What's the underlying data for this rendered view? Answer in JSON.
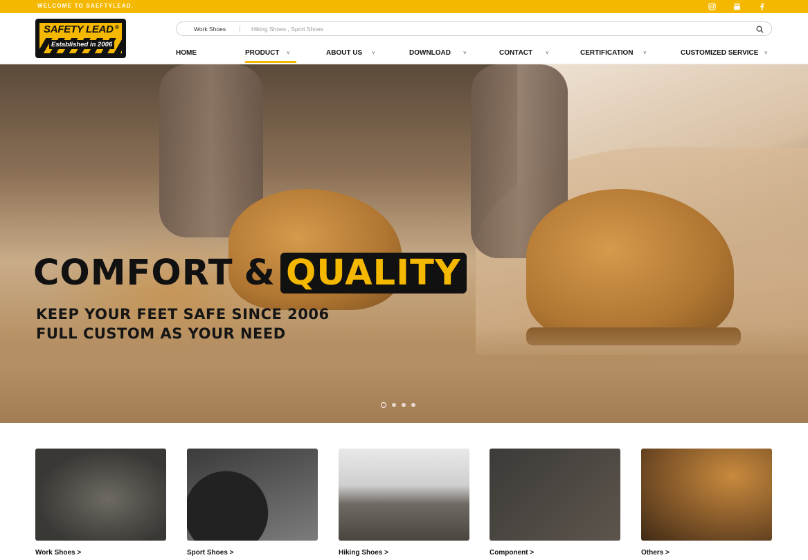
{
  "topbar": {
    "welcome_text": "WELCOME TO SAEFTYLEAD.",
    "social_icons": [
      "instagram-icon",
      "youtube-icon",
      "facebook-icon"
    ]
  },
  "logo": {
    "name": "SAFETY LEAD",
    "registered": "®",
    "tagline": "Established in 2006"
  },
  "search": {
    "category": "Work Shoes",
    "placeholder": "Hiking Shoes , Sport Shoes"
  },
  "nav": {
    "items": [
      {
        "label": "HOME",
        "has_dropdown": false
      },
      {
        "label": "PRODUCT",
        "has_dropdown": true,
        "active": true
      },
      {
        "label": "ABOUT US",
        "has_dropdown": true
      },
      {
        "label": "DOWNLOAD",
        "has_dropdown": true
      },
      {
        "label": "CONTACT",
        "has_dropdown": true
      },
      {
        "label": "CERTIFICATION",
        "has_dropdown": true
      },
      {
        "label": "CUSTOMIZED SERVICE",
        "has_dropdown": true
      }
    ],
    "caret": "˅"
  },
  "hero": {
    "title_part1": "COMFORT",
    "title_amp": "&",
    "title_part2": "QUALITY",
    "subtitle_line1": "KEEP YOUR FEET SAFE SINCE 2006",
    "subtitle_line2": "FULL CUSTOM AS YOUR NEED",
    "slide_count": 4,
    "active_slide": 1
  },
  "categories": [
    {
      "label": "Work Shoes >"
    },
    {
      "label": "Sport Shoes >"
    },
    {
      "label": "Hiking Shoes >"
    },
    {
      "label": "Component >"
    },
    {
      "label": "Others >"
    }
  ],
  "colors": {
    "accent": "#f5b800",
    "dark": "#111111"
  }
}
